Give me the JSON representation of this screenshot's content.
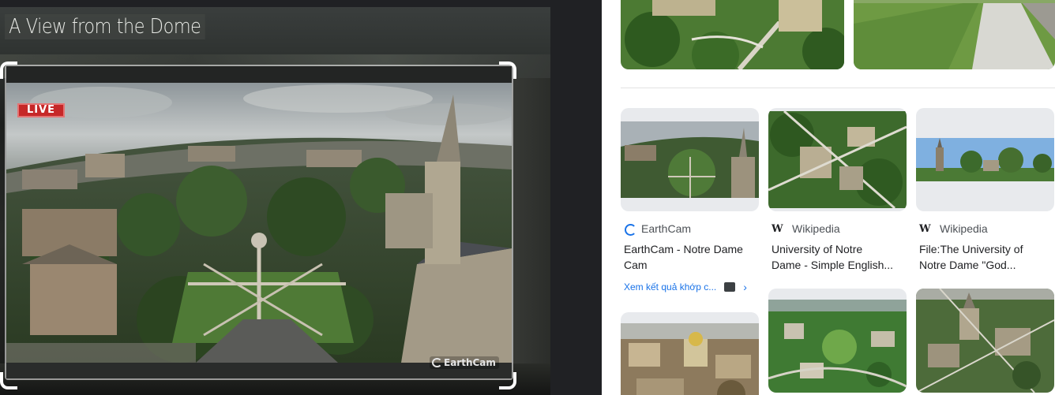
{
  "viewer": {
    "title": "A View from the Dome",
    "live_label": "LIVE",
    "watermark": "EarthCam"
  },
  "results": {
    "cards": [
      {
        "source": "EarthCam",
        "title_line1": "EarthCam - Notre Dame",
        "title_line2": "Cam",
        "more_link": "Xem kết quả khớp c...",
        "icon": "earthcam-icon"
      },
      {
        "source": "Wikipedia",
        "title_line1": "University of Notre",
        "title_line2": "Dame - Simple English...",
        "icon": "wikipedia-icon"
      },
      {
        "source": "Wikipedia",
        "title_line1": "File:The University of",
        "title_line2": "Notre Dame \"God...",
        "icon": "wikipedia-icon"
      }
    ]
  },
  "colors": {
    "viewer_bg": "#202124",
    "live_red": "#c62828",
    "link_blue": "#1a73e8",
    "text_primary": "#202124",
    "text_secondary": "#4d5156"
  }
}
